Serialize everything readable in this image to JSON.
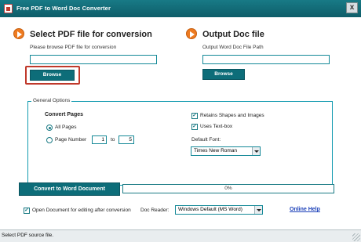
{
  "window": {
    "title": "Free PDF to Word Doc Converter",
    "close_label": "x"
  },
  "input_section": {
    "heading": "Select PDF file for conversion",
    "instruction": "Please browse PDF file for conversion",
    "path_value": "",
    "browse_label": "Browse"
  },
  "output_section": {
    "heading": "Output Doc file",
    "instruction": "Output Word Doc File Path",
    "path_value": "",
    "browse_label": "Browse"
  },
  "general_options": {
    "legend": "General Options",
    "convert_pages_label": "Convert Pages",
    "all_pages_label": "All Pages",
    "all_pages_selected": true,
    "page_number_label": "Page Number",
    "page_from": "1",
    "to_label": "to",
    "page_to": "5",
    "retain_shapes_label": "Retains Shapes and Images",
    "retain_shapes_checked": true,
    "uses_textbox_label": "Uses Text-box",
    "uses_textbox_checked": true,
    "default_font_label": "Default Font:",
    "default_font_value": "Times New Roman"
  },
  "conversion": {
    "convert_button_label": "Convert to Word Document",
    "progress_percent": 0,
    "progress_text": "0%"
  },
  "footer_options": {
    "open_document_label": "Open Document for editing after conversion",
    "open_document_checked": true,
    "doc_reader_label": "Doc Reader:",
    "doc_reader_value": "Windows Default (MS Word)",
    "online_help_label": "Online Help"
  },
  "status": {
    "text": "Select PDF source file."
  },
  "colors": {
    "accent": "#0d6d79",
    "arrow": "#ee7b21",
    "highlight": "#c0392b",
    "link": "#1a3fb8"
  }
}
